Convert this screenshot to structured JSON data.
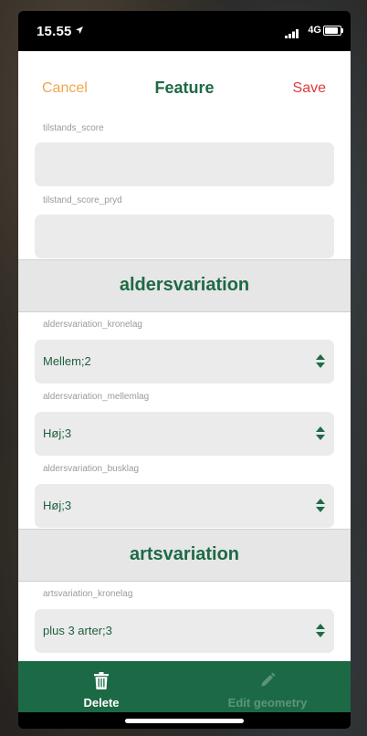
{
  "status_bar": {
    "time": "15.55",
    "network": "4G"
  },
  "header": {
    "cancel_label": "Cancel",
    "title": "Feature",
    "save_label": "Save"
  },
  "fields": {
    "tilstands_score": {
      "label": "tilstands_score",
      "value": ""
    },
    "tilstand_score_pryd": {
      "label": "tilstand_score_pryd",
      "value": ""
    }
  },
  "sections": {
    "aldersvariation": {
      "title": "aldersvariation",
      "kronelag": {
        "label": "aldersvariation_kronelag",
        "value": "Mellem;2"
      },
      "mellemlag": {
        "label": "aldersvariation_mellemlag",
        "value": "Høj;3"
      },
      "busklag": {
        "label": "aldersvariation_busklag",
        "value": "Høj;3"
      }
    },
    "artsvariation": {
      "title": "artsvariation",
      "kronelag": {
        "label": "artsvariation_kronelag",
        "value": "plus 3 arter;3"
      }
    }
  },
  "bottom_bar": {
    "delete_label": "Delete",
    "edit_label": "Edit geometry"
  },
  "colors": {
    "brand_green": "#1e6a46",
    "cancel_orange": "#f0a64a",
    "save_red": "#e23a3a",
    "disabled_green": "#5d9478"
  },
  "icons": {
    "delete": "trash-icon",
    "edit": "pencil-icon",
    "select": "sort-arrows-icon"
  }
}
